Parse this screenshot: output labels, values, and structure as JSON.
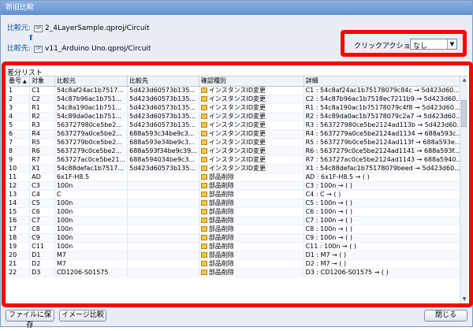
{
  "window": {
    "title": "新旧比較"
  },
  "sources": {
    "original_label": "比較元:",
    "original_file": "2_4LayerSample.qproj/Circuit",
    "target_label": "比較先:",
    "target_file": "v11_Arduino Uno.qproj/Circuit"
  },
  "click_action": {
    "label": "クリックアクション",
    "value": "なし"
  },
  "diff": {
    "title": "差分リスト",
    "columns": [
      "番号",
      "対象",
      "比較元",
      "比較先",
      "確認種別",
      "詳細"
    ],
    "rows": [
      [
        "1",
        "C1",
        "54c8af24ac1b7517...",
        "5d423d60573b135...",
        "インスタンスID変更",
        "C1 : 54c8af24ac1b75178079c84c → 5d423d60..."
      ],
      [
        "2",
        "C2",
        "54c87b96ac1b751...",
        "5d423d60573b135...",
        "インスタンスID変更",
        "C2 : 54c87b96ac1b7518ec7211b9 → 5d423d60..."
      ],
      [
        "3",
        "R1",
        "54c8a190ac1b751...",
        "5d423d60573b135...",
        "インスタンスID変更",
        "R1 : 54c8a190ac1b75178079c4f8 → 5d423d60..."
      ],
      [
        "4",
        "R2",
        "54c89da0ac1b751...",
        "5d423d60573b135...",
        "インスタンスID変更",
        "R2 : 54c89da0ac1b75178079c2a7 → 5d423d60..."
      ],
      [
        "5",
        "R3",
        "563727980ce5be2...",
        "5d423d60573b135...",
        "インスタンスID変更",
        "R3 : 563727980ce5be2124ad113b → 5d423d60..."
      ],
      [
        "6",
        "R4",
        "5637279a0ce5be2...",
        "688a593c34be9c3...",
        "インスタンスID変更",
        "R4 : 5637279a0ce5be2124ad1134 → 688a593c..."
      ],
      [
        "7",
        "R5",
        "5637279b0ce5be2...",
        "688a593e34be9c3...",
        "インスタンスID変更",
        "R5 : 5637279b0ce5be2124ad113f → 688a593e..."
      ],
      [
        "8",
        "R6",
        "5637279c0ce5be2...",
        "688a593f34be9c39...",
        "インスタンスID変更",
        "R6 : 5637279c0ce5be2124ad1141 → 688a593f..."
      ],
      [
        "9",
        "R7",
        "563727ac0ce5be21...",
        "688a594034be9c3...",
        "インスタンスID変更",
        "R7 : 563727ac0ce5be2124ad1143 → 688a5940..."
      ],
      [
        "10",
        "X1",
        "54c88defac1b7517...",
        "5d423d60573b135...",
        "インスタンスID変更",
        "X1 : 54c88defac1b75178079beed → 5d423d60..."
      ],
      [
        "11",
        "AD",
        "6x1F-H8.5",
        "",
        "部品削除",
        "AD : 6x1F-H8.5 → ( )"
      ],
      [
        "12",
        "C3",
        "100n",
        "",
        "部品削除",
        "C3 : 100n → ( )"
      ],
      [
        "13",
        "C4",
        "C",
        "",
        "部品削除",
        "C4 : C → ( )"
      ],
      [
        "14",
        "C5",
        "100n",
        "",
        "部品削除",
        "C5 : 100n → ( )"
      ],
      [
        "15",
        "C6",
        "100n",
        "",
        "部品削除",
        "C6 : 100n → ( )"
      ],
      [
        "16",
        "C7",
        "100n",
        "",
        "部品削除",
        "C7 : 100n → ( )"
      ],
      [
        "17",
        "C8",
        "100n",
        "",
        "部品削除",
        "C8 : 100n → ( )"
      ],
      [
        "18",
        "C9",
        "100n",
        "",
        "部品削除",
        "C9 : 100n → ( )"
      ],
      [
        "19",
        "C11",
        "100n",
        "",
        "部品削除",
        "C11 : 100n → ( )"
      ],
      [
        "20",
        "D1",
        "M7",
        "",
        "部品削除",
        "D1 : M7 → ( )"
      ],
      [
        "21",
        "D2",
        "M7",
        "",
        "部品削除",
        "D2 : M7 → ( )"
      ],
      [
        "22",
        "D3",
        "CD1206-S01575",
        "",
        "部品削除",
        "D3 : CD1206-S01575 → ( )"
      ]
    ]
  },
  "buttons": {
    "save_file": "ファイルに保存",
    "image_compare": "イメージ比較",
    "close": "閉じる"
  }
}
